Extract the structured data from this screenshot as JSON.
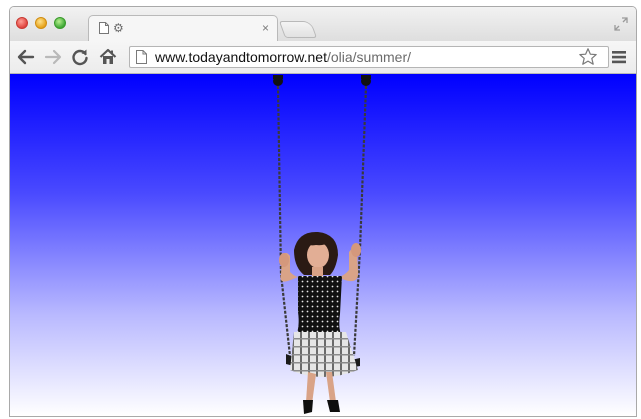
{
  "window": {
    "controls": [
      "close",
      "minimize",
      "maximize"
    ]
  },
  "tab": {
    "title": "",
    "close_glyph": "×",
    "icons": [
      "page-icon",
      "gear-icon"
    ]
  },
  "toolbar": {
    "back_icon": "back-arrow-icon",
    "forward_icon": "forward-arrow-icon",
    "reload_icon": "reload-icon",
    "home_icon": "home-icon",
    "bookmark_icon": "star-icon",
    "menu_icon": "hamburger-menu-icon"
  },
  "address_bar": {
    "host": "www.todayandtomorrow.net",
    "path": "/olia/summer/"
  },
  "page": {
    "background_gradient": [
      "#0000ff",
      "#ffffff"
    ],
    "figure": "woman-on-swing"
  }
}
